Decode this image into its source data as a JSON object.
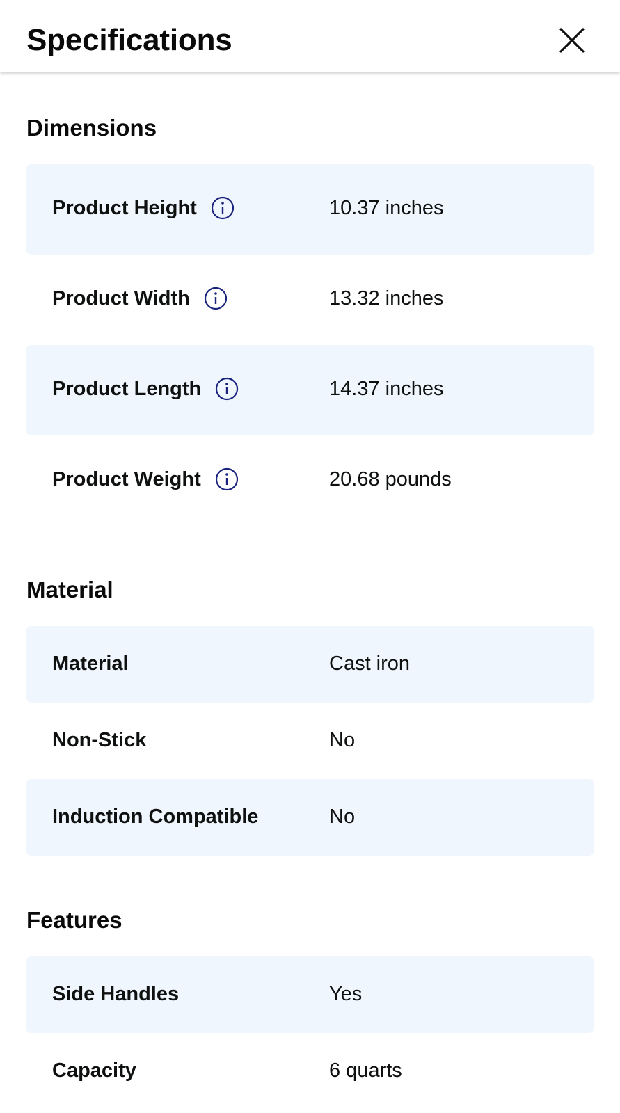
{
  "header": {
    "title": "Specifications",
    "close_icon": "close-icon"
  },
  "colors": {
    "shaded_row": "#f0f6fd",
    "info_icon": "#1a237e",
    "text": "#0f1111"
  },
  "sections": {
    "dimensions": {
      "title": "Dimensions",
      "rows": [
        {
          "label": "Product Height",
          "value": "10.37 inches",
          "icon": "info-icon"
        },
        {
          "label": "Product Width",
          "value": "13.32 inches",
          "icon": "info-icon"
        },
        {
          "label": "Product Length",
          "value": "14.37 inches",
          "icon": "info-icon"
        },
        {
          "label": "Product Weight",
          "value": "20.68 pounds",
          "icon": "info-icon"
        }
      ]
    },
    "material": {
      "title": "Material",
      "rows": [
        {
          "label": "Material",
          "value": "Cast iron"
        },
        {
          "label": "Non-Stick",
          "value": "No"
        },
        {
          "label": "Induction Compatible",
          "value": "No"
        }
      ]
    },
    "features": {
      "title": "Features",
      "rows": [
        {
          "label": "Side Handles",
          "value": "Yes"
        },
        {
          "label": "Capacity",
          "value": "6 quarts"
        }
      ]
    }
  }
}
